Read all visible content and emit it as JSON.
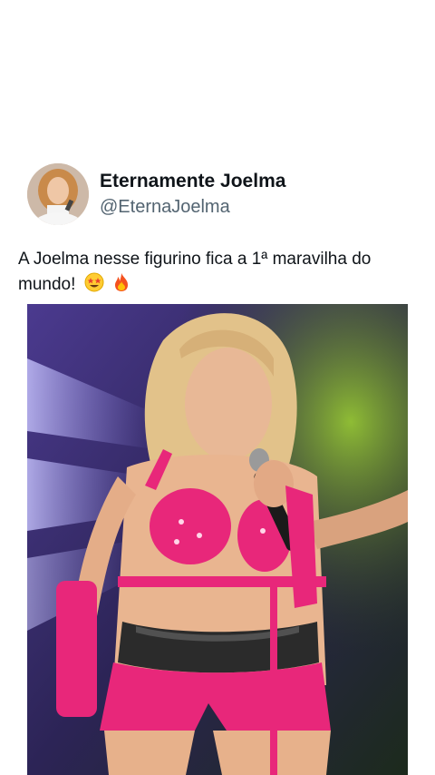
{
  "tweet": {
    "display_name": "Eternamente Joelma",
    "handle": "@EternaJoelma",
    "text": "A Joelma nesse figurino fica a 1ª maravilha do mundo!",
    "emojis": [
      "star-struck-emoji",
      "fire-emoji"
    ]
  },
  "media": {
    "type": "photo"
  },
  "colors": {
    "text": "#0f1419",
    "secondary_text": "#536471",
    "costume_pink": "#e8277a",
    "background": "#ffffff"
  }
}
